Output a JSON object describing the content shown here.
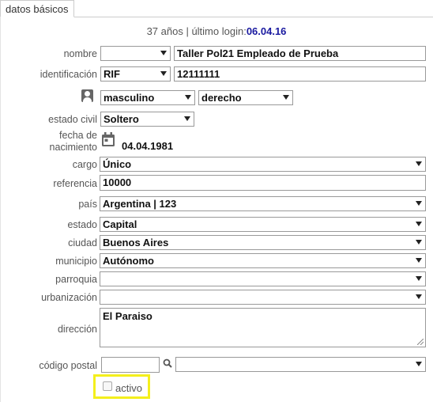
{
  "tabs": {
    "basic": "datos básicos"
  },
  "header": {
    "age_prefix": "37 años | último login:",
    "last_login": "06.04.16"
  },
  "labels": {
    "nombre": "nombre",
    "identificacion": "identificación",
    "estado_civil": "estado civil",
    "fecha_line1": "fecha de",
    "fecha_line2": "nacimiento",
    "cargo": "cargo",
    "referencia": "referencia",
    "pais": "país",
    "estado": "estado",
    "ciudad": "ciudad",
    "municipio": "municipio",
    "parroquia": "parroquia",
    "urbanizacion": "urbanización",
    "direccion": "dirección",
    "codigo_postal": "código postal",
    "activo": "activo"
  },
  "values": {
    "title_select": "",
    "nombre": "Taller Pol21 Empleado de Prueba",
    "id_type": "RIF",
    "id_number": "12111111",
    "gender": "masculino",
    "hand": "derecho",
    "estado_civil": "Soltero",
    "fecha_nacimiento": "04.04.1981",
    "cargo": "Único",
    "referencia": "10000",
    "pais": "Argentina | 123",
    "estado": "Capital",
    "ciudad": "Buenos Aires",
    "municipio": "Autónomo",
    "parroquia": "",
    "urbanizacion": "",
    "direccion": "El Paraiso",
    "codigo_postal": "",
    "postal_lookup": "",
    "activo": false
  },
  "icons": {
    "person": "person-icon",
    "calendar": "calendar-icon",
    "search": "search-icon"
  },
  "colors": {
    "login_date": "#1a1aa0",
    "highlight": "#f4ef1c"
  }
}
